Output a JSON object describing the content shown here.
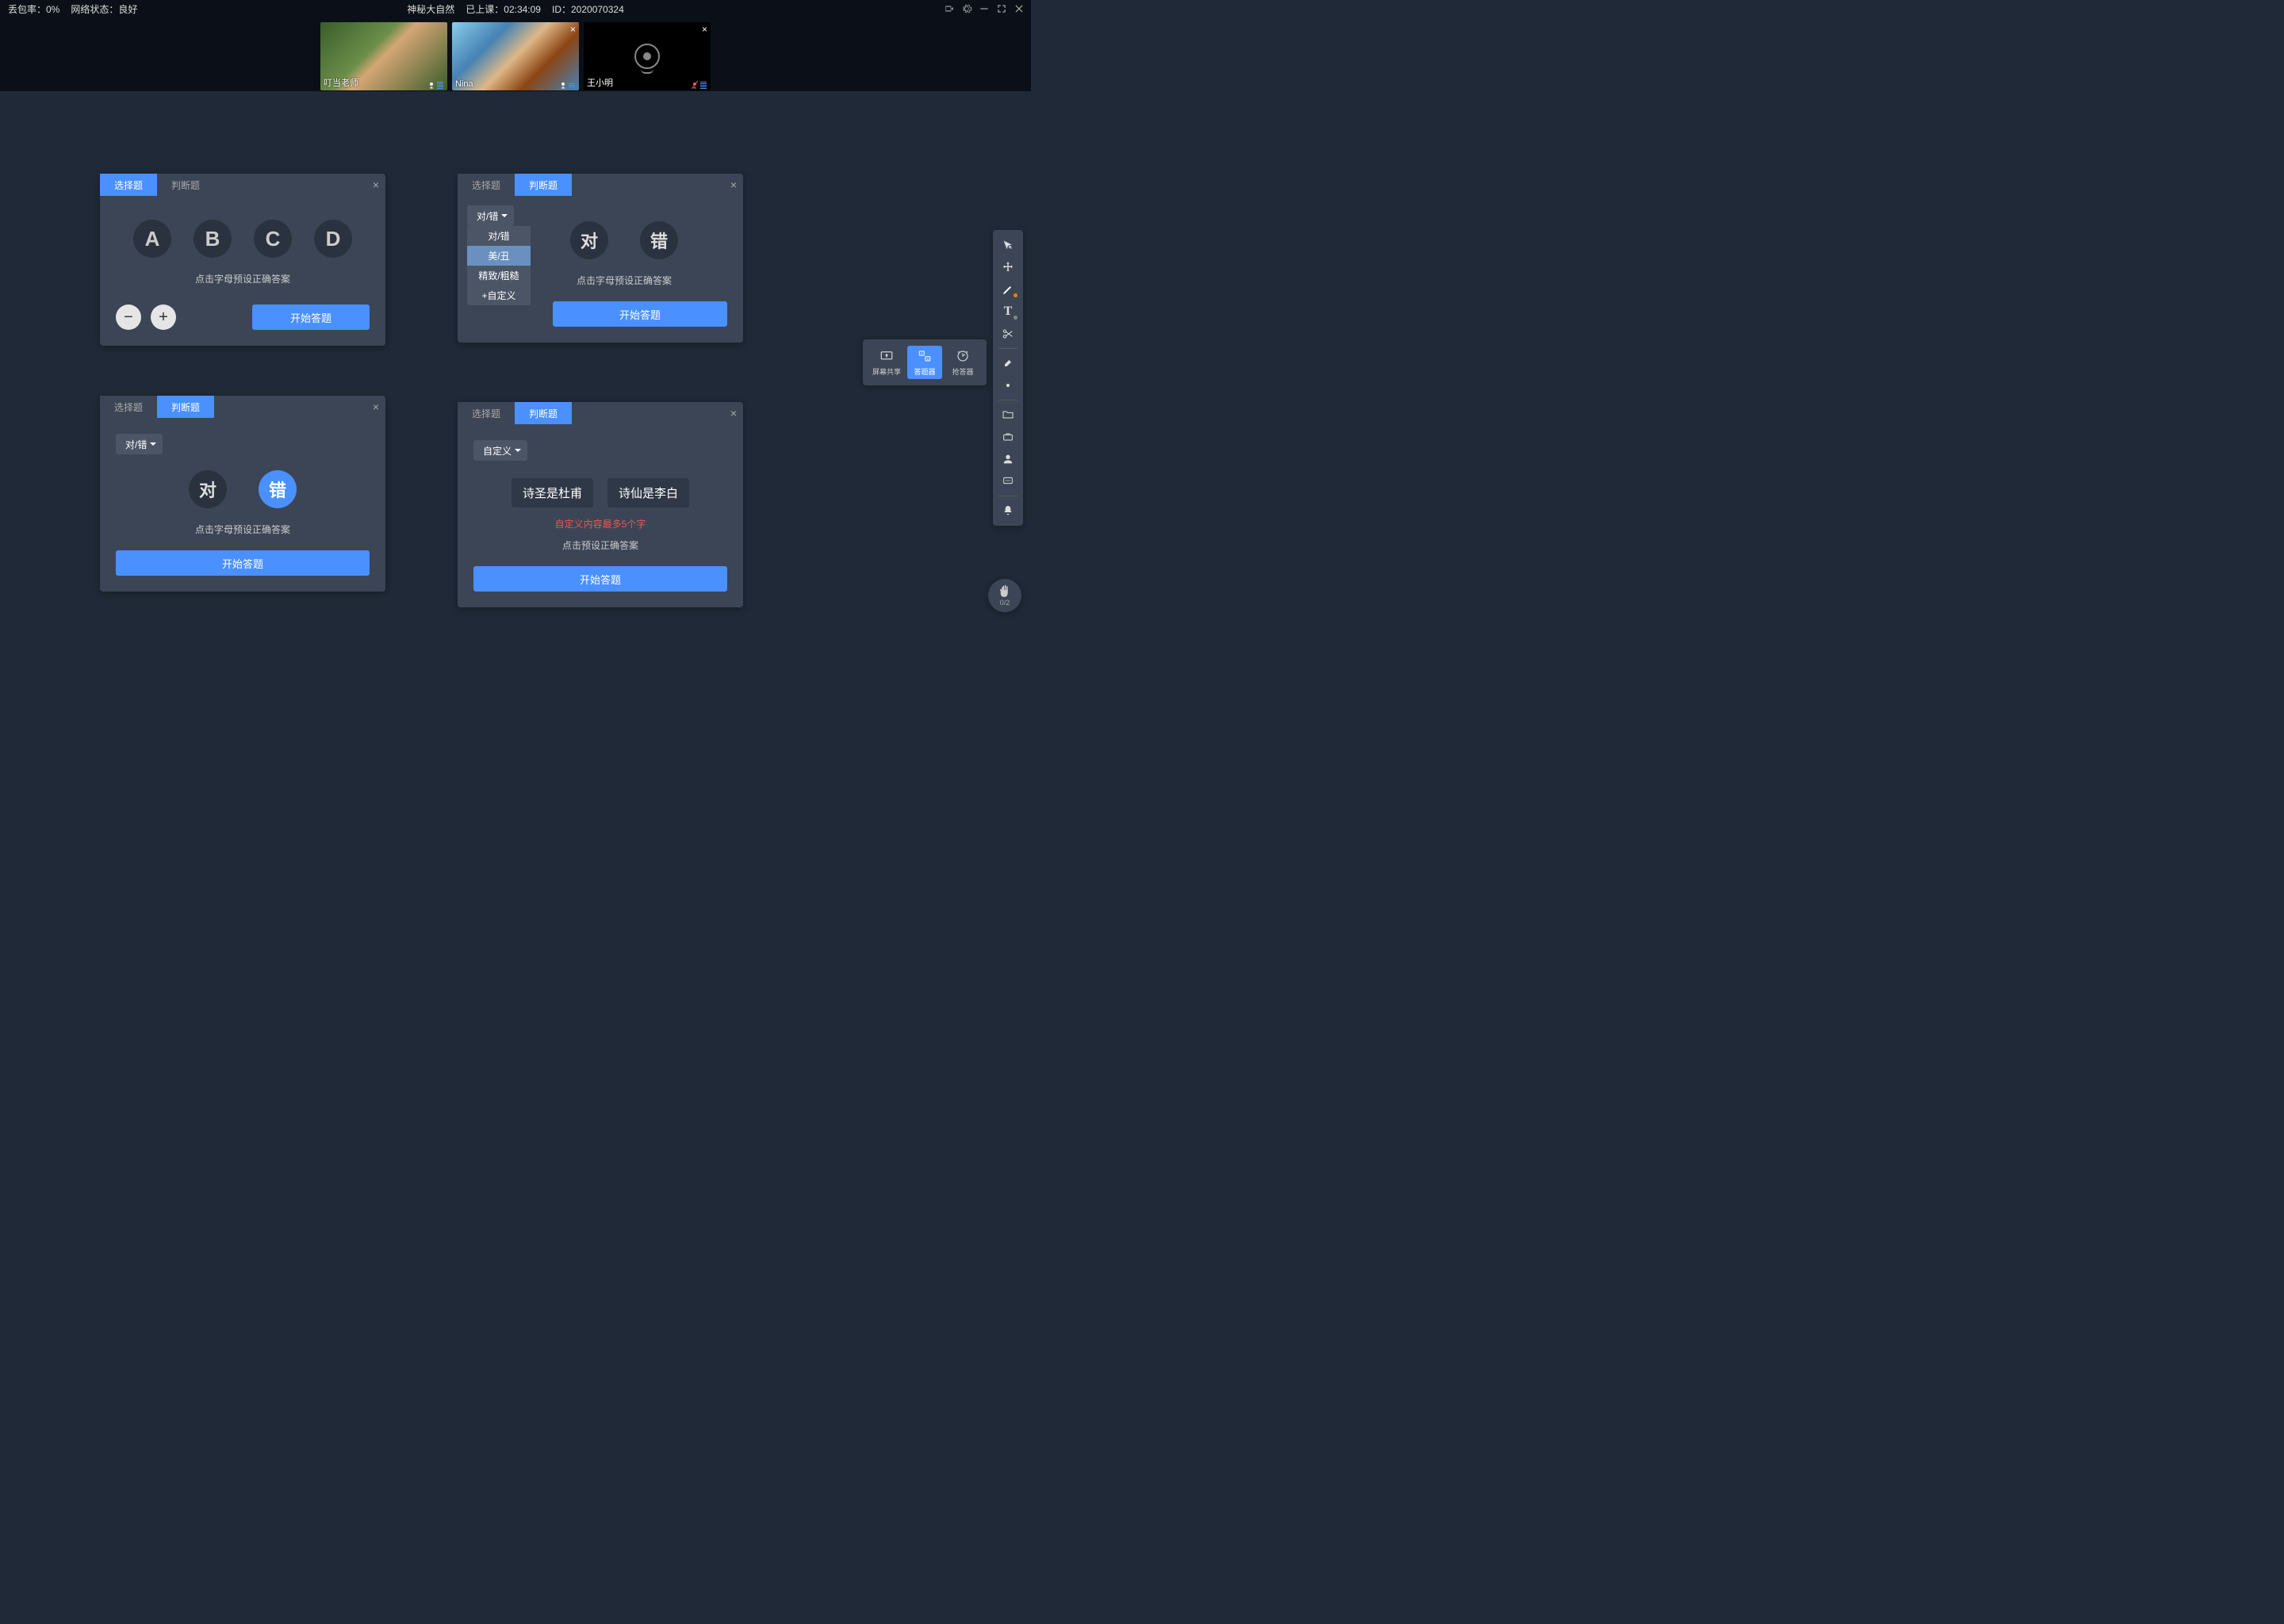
{
  "topbar": {
    "packet_loss_label": "丢包率：0%",
    "network_label": "网络状态：良好",
    "title": "神秘大自然",
    "elapsed_label": "已上课：",
    "elapsed_time": "02:34:09",
    "id_label": "ID：",
    "id_value": "2020070324"
  },
  "videos": [
    {
      "name": "叮当老师",
      "cam_off": false,
      "closeable": false
    },
    {
      "name": "Nina",
      "cam_off": false,
      "closeable": true
    },
    {
      "name": "王小明",
      "cam_off": true,
      "closeable": true,
      "muted": true
    }
  ],
  "panel1": {
    "tabs": [
      "选择题",
      "判断题"
    ],
    "active_tab": 0,
    "letters": [
      "A",
      "B",
      "C",
      "D"
    ],
    "hint": "点击字母预设正确答案",
    "start": "开始答题"
  },
  "panel2": {
    "tabs": [
      "选择题",
      "判断题"
    ],
    "active_tab": 1,
    "dd_label": "对/错",
    "dd_items": [
      "对/错",
      "美/丑",
      "精致/粗糙",
      "+自定义"
    ],
    "dd_active": 1,
    "tf": [
      "对",
      "错"
    ],
    "hint": "点击字母预设正确答案",
    "start": "开始答题"
  },
  "panel3": {
    "tabs": [
      "选择题",
      "判断题"
    ],
    "active_tab": 1,
    "dd_label": "对/错",
    "tf": [
      "对",
      "错"
    ],
    "tf_selected": 1,
    "hint": "点击字母预设正确答案",
    "start": "开始答题"
  },
  "panel4": {
    "tabs": [
      "选择题",
      "判断题"
    ],
    "active_tab": 1,
    "dd_label": "自定义",
    "options": [
      "诗圣是杜甫",
      "诗仙是李白"
    ],
    "error": "自定义内容最多5个字",
    "hint": "点击预设正确答案",
    "start": "开始答题"
  },
  "popout": {
    "items": [
      {
        "label": "屏幕共享",
        "id": "screen-share"
      },
      {
        "label": "答题器",
        "id": "answer-tool"
      },
      {
        "label": "抢答器",
        "id": "buzzer"
      }
    ],
    "active": 1
  },
  "hand": {
    "count": "0/2"
  }
}
